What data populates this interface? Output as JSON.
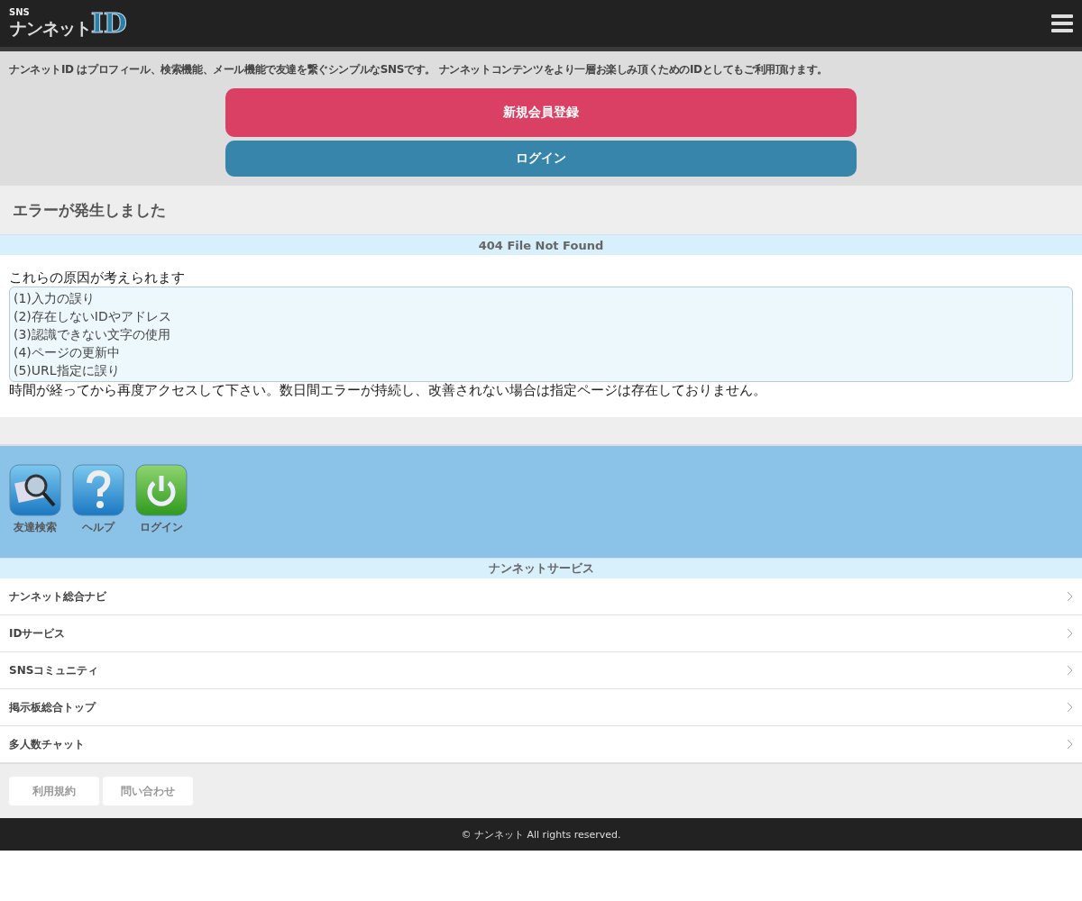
{
  "logo": {
    "small": "SNS",
    "main": "ナンネット",
    "id": "ID"
  },
  "intro": "ナンネットID はプロフィール、検索機能、メール機能で友達を繋ぐシンプルなSNSです。 ナンネットコンテンツをより一層お楽しみ頂くためのIDとしてもご利用頂けます。",
  "buttons": [
    {
      "label": "新規会員登録",
      "kind": "register"
    },
    {
      "label": "ログイン",
      "kind": "login"
    }
  ],
  "error": {
    "title": "エラーが発生しました",
    "code": "404 File Not Found",
    "lead": "これらの原因が考えられます",
    "causes": [
      "(1)入力の誤り",
      "(2)存在しないIDやアドレス",
      "(3)認識できない文字の使用",
      "(4)ページの更新中",
      "(5)URL指定に誤り"
    ],
    "note": "時間が経ってから再度アクセスして下さい。数日間エラーが持続し、改善されない場合は指定ページは存在しておりません。"
  },
  "apps": [
    {
      "label": "友達検索",
      "kind": "search"
    },
    {
      "label": "ヘルプ",
      "kind": "help"
    },
    {
      "label": "ログイン",
      "kind": "power"
    }
  ],
  "services": {
    "title": "ナンネットサービス",
    "items": [
      "ナンネット総合ナビ",
      "IDサービス",
      "SNSコミュニティ",
      "掲示板総合トップ",
      "多人数チャット"
    ]
  },
  "footer_links": [
    "利用規約",
    "問い合わせ"
  ],
  "copyright": "© ナンネット All rights reserved."
}
